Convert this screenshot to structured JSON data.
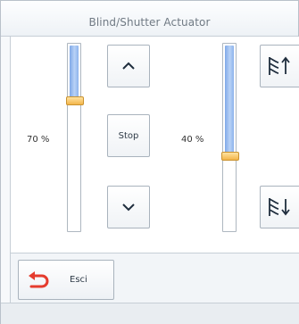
{
  "window": {
    "title": "Blind/Shutter Actuator"
  },
  "blind1": {
    "level_label": "70 %",
    "level": 0.7,
    "up_icon": "chevron-up-icon",
    "stop_label": "Stop",
    "down_icon": "chevron-down-icon"
  },
  "blind2": {
    "level_label": "40 %",
    "level": 0.4,
    "open_icon": "slats-open-up-icon",
    "close_icon": "slats-close-down-icon"
  },
  "footer": {
    "exit_label": "Esci",
    "exit_icon": "undo-arrow-icon"
  },
  "colors": {
    "slider_fill": "#9cc0f2",
    "thumb": "#f3b54a",
    "exit_icon": "#e53c2e"
  }
}
